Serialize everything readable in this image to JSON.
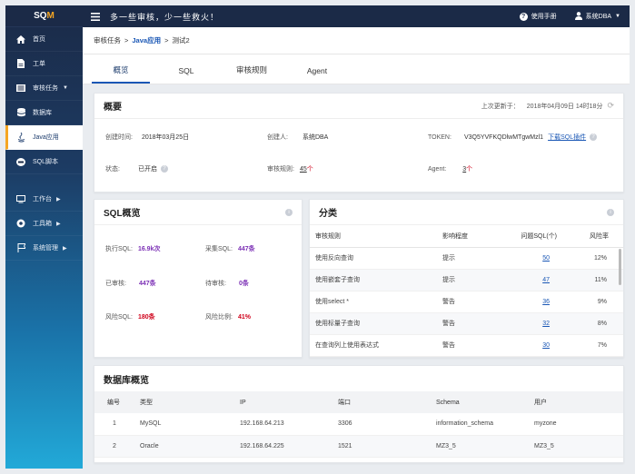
{
  "app": {
    "logo_a": "SQ",
    "logo_b": "M"
  },
  "sidebar": {
    "items": [
      {
        "label": "首页",
        "icon": "home-icon"
      },
      {
        "label": "工单",
        "icon": "doc-icon"
      },
      {
        "label": "审核任务",
        "icon": "task-icon",
        "arrow": "▼"
      },
      {
        "label": "数据库",
        "icon": "database-icon"
      },
      {
        "label": "Java应用",
        "icon": "java-icon"
      },
      {
        "label": "SQL脚本",
        "icon": "sql-script-icon"
      },
      {
        "label": "工作台",
        "icon": "desktop-icon",
        "arrow": "▶"
      },
      {
        "label": "工具箱",
        "icon": "toolbox-icon",
        "arrow": "▶"
      },
      {
        "label": "系统管理",
        "icon": "flag-icon",
        "arrow": "▶"
      }
    ]
  },
  "topbar": {
    "slogan": "多一些审核，少一些救火！",
    "help": "使用手册",
    "user": "系统DBA",
    "user_arrow": "▼"
  },
  "breadcrumb": {
    "a": "审核任务",
    "sep1": ">",
    "b": "Java应用",
    "sep2": ">",
    "c": "测试2"
  },
  "tabs": [
    "概览",
    "SQL",
    "审核规则",
    "Agent"
  ],
  "overview": {
    "title": "概要",
    "updated_label": "上次更新于：",
    "updated_value": "2018年04月09日 14时18分",
    "created_time_label": "创建时间:",
    "created_time": "2018年03月25日",
    "creator_label": "创建人:",
    "creator": "系统DBA",
    "token_label": "TOKEN:",
    "token": "V3Q5YVFKQDlwMTgwMzl1",
    "download": "下载SQL插件",
    "status_label": "状态:",
    "status": "已开启",
    "rules_label": "审核规则:",
    "rules_num": "45",
    "rules_unit": "个",
    "agent_label": "Agent:",
    "agent_num": "3",
    "agent_unit": "个"
  },
  "sql_overview": {
    "title": "SQL概览",
    "exec_label": "执行SQL:",
    "exec": "16.9k次",
    "collect_label": "采集SQL:",
    "collect": "447条",
    "audited_label": "已审核:",
    "audited": "447条",
    "pending_label": "待审核:",
    "pending": "0条",
    "risk_label": "风险SQL:",
    "risk": "180条",
    "ratio_label": "风险比例:",
    "ratio": "41%"
  },
  "category": {
    "title": "分类",
    "headers": [
      "审核规则",
      "影响程度",
      "问题SQL(个)",
      "风险率"
    ],
    "rows": [
      {
        "rule": "使用反向查询",
        "level": "提示",
        "count": "50",
        "rate": "12%"
      },
      {
        "rule": "使用嵌套子查询",
        "level": "提示",
        "count": "47",
        "rate": "11%"
      },
      {
        "rule": "使用select *",
        "level": "警告",
        "count": "36",
        "rate": "9%"
      },
      {
        "rule": "使用标量子查询",
        "level": "警告",
        "count": "32",
        "rate": "8%"
      },
      {
        "rule": "在查询列上使用表达式",
        "level": "警告",
        "count": "30",
        "rate": "7%"
      }
    ]
  },
  "db_overview": {
    "title": "数据库概览",
    "headers": [
      "编号",
      "类型",
      "IP",
      "端口",
      "Schema",
      "用户"
    ],
    "rows": [
      {
        "no": "1",
        "type": "MySQL",
        "ip": "192.168.64.213",
        "port": "3306",
        "schema": "information_schema",
        "user": "myzone"
      },
      {
        "no": "2",
        "type": "Oracle",
        "ip": "192.168.64.225",
        "port": "1521",
        "schema": "MZ3_5",
        "user": "MZ3_5"
      }
    ]
  },
  "colors": {
    "accent": "#1a57b5",
    "warning": "#f5a623",
    "danger": "#d0021b",
    "success": "#2a9d3a",
    "nav": "#1b2a47"
  }
}
